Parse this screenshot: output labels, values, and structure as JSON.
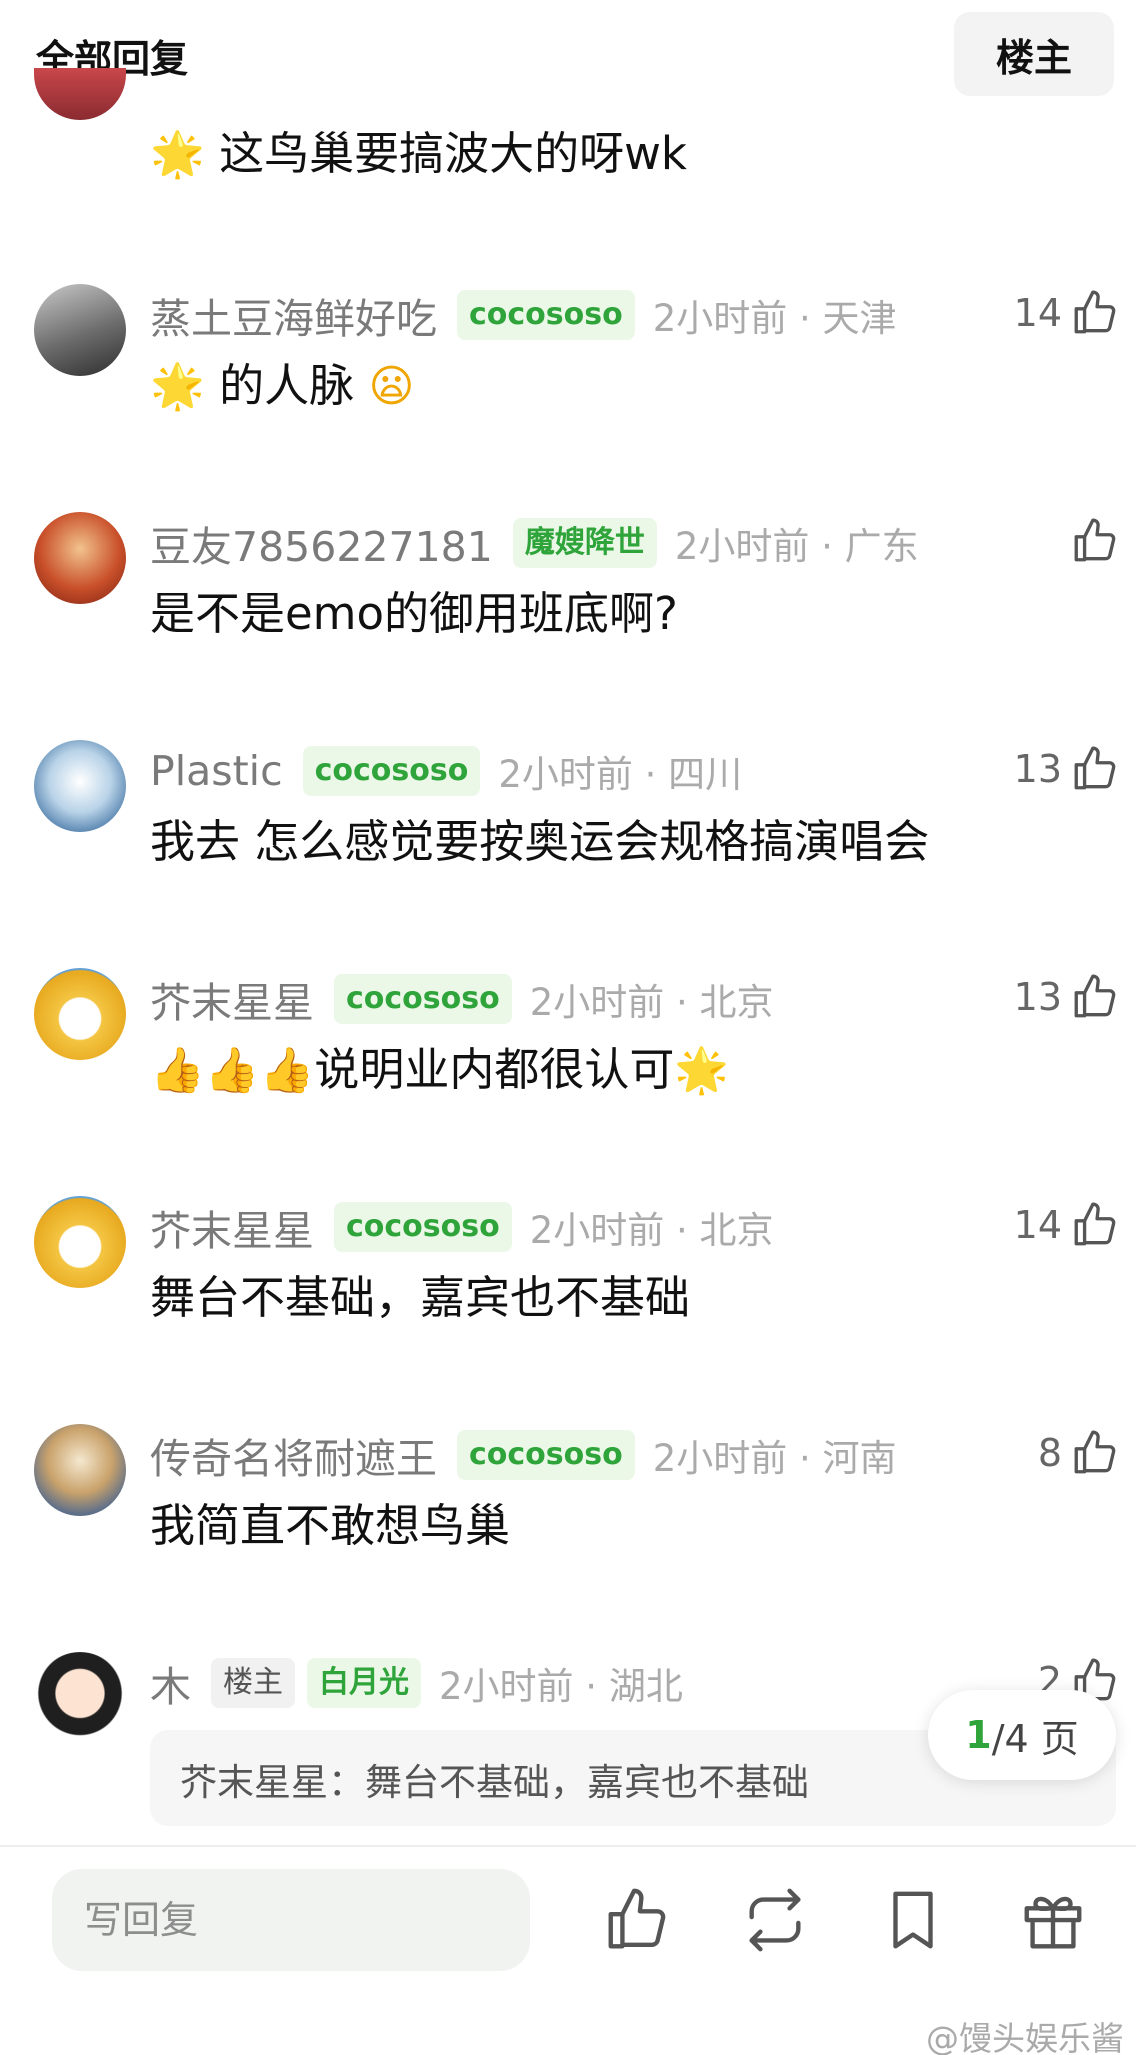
{
  "header": {
    "title": "全部回复",
    "owner_button": "楼主"
  },
  "comments": [
    {
      "name": "",
      "tag": "",
      "time_loc": "",
      "likes": "",
      "text": "这鸟巢要搞波大的呀wk"
    },
    {
      "name": "蒸土豆海鲜好吃",
      "tag": "cocososo",
      "time_loc": "2小时前 · 天津",
      "likes": "14",
      "text": "的人脉"
    },
    {
      "name": "豆友7856227181",
      "tag": "魔嫂降世",
      "time_loc": "2小时前 · 广东",
      "likes": "",
      "text": "是不是emo的御用班底啊?"
    },
    {
      "name": "Plastic",
      "tag": "cocososo",
      "time_loc": "2小时前 · 四川",
      "likes": "13",
      "text": "我去 怎么感觉要按奥运会规格搞演唱会"
    },
    {
      "name": "芥末星星",
      "tag": "cocososo",
      "time_loc": "2小时前 · 北京",
      "likes": "13",
      "text": "说明业内都很认可"
    },
    {
      "name": "芥末星星",
      "tag": "cocososo",
      "time_loc": "2小时前 · 北京",
      "likes": "14",
      "text": "舞台不基础，嘉宾也不基础"
    },
    {
      "name": "传奇名将耐遮王",
      "tag": "cocososo",
      "time_loc": "2小时前 · 河南",
      "likes": "8",
      "text": "我简直不敢想鸟巢"
    },
    {
      "name": "木",
      "owner_tag": "楼主",
      "tag": "白月光",
      "time_loc": "2小时前 · 湖北",
      "likes": "2",
      "quote": "芥末星星：舞台不基础，嘉宾也不基础"
    }
  ],
  "pager": {
    "current": "1",
    "total": "/4 页"
  },
  "bottom_bar": {
    "reply_placeholder": "写回复"
  },
  "watermark": "@馒头娱乐酱",
  "colors": {
    "accent": "#2fa43a",
    "tag_bg": "#ebf8e8",
    "muted": "#aaaaaa"
  }
}
